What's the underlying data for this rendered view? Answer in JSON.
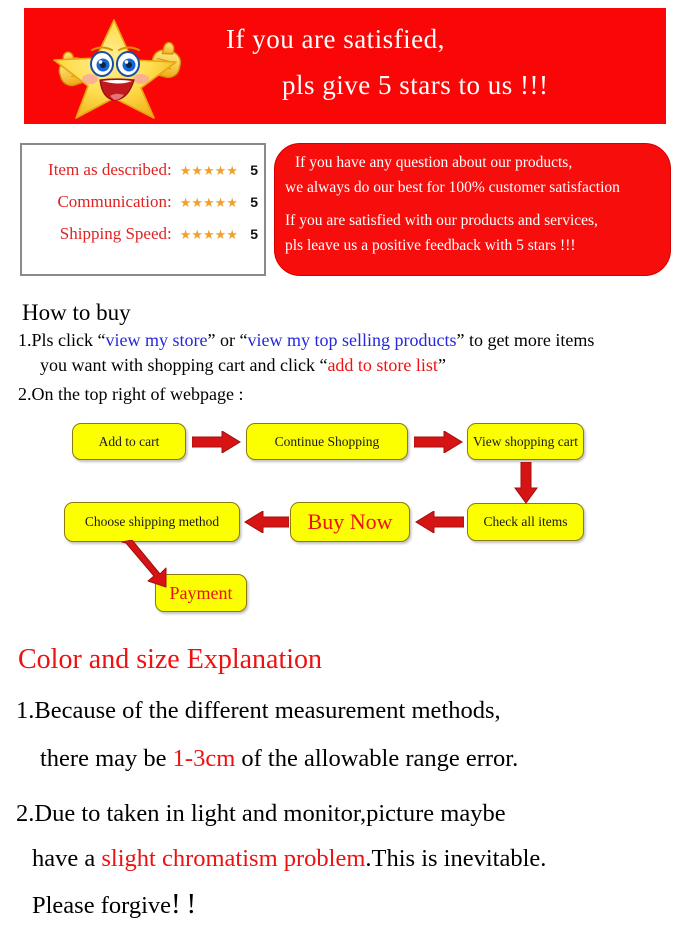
{
  "banner": {
    "bg_color": "#fb0606",
    "text_color": "#ffffff",
    "line1": "If you are satisfied,",
    "line2": "pls give 5 stars to us !!!",
    "mascot": "smiling-star-thumbs-up"
  },
  "ratings": {
    "border_color": "#8a8a8a",
    "label_color": "#e12222",
    "star_color": "#f0a030",
    "rows": [
      {
        "label": "Item as described:",
        "stars": "★★★★★",
        "score": "5"
      },
      {
        "label": "Communication:",
        "stars": "★★★★★",
        "score": "5"
      },
      {
        "label": "Shipping Speed:",
        "stars": "★★★★★",
        "score": "5"
      }
    ]
  },
  "message_box": {
    "bg_color": "#f80d0d",
    "text_color": "#ffffff",
    "line1": "If you have any question about our products,",
    "line2": "we always do our best for 100% customer satisfaction",
    "line3": "If you are satisfied with our products and services,",
    "line4": "pls leave us a positive feedback with 5 stars !!!"
  },
  "how_to_buy": {
    "title": "How to buy",
    "step1_prefix": "1.Pls click “",
    "step1_link1": "view my store",
    "step1_mid": "” or “",
    "step1_link2": "view my top selling products",
    "step1_suffix": "” to get more items",
    "step1b_prefix": "you want with shopping cart and click “",
    "step1b_red": "add to store list",
    "step1b_suffix": "”",
    "step2": "2.On the top right of webpage :",
    "link_color": "#2626dd",
    "highlight_color": "#ee1111"
  },
  "flowchart": {
    "box_fill": "#fcff00",
    "box_border": "#8a7a10",
    "arrow_color": "#d61414",
    "accent_text_color": "#ee1111",
    "boxes": {
      "add_to_cart": "Add to cart",
      "continue_shopping": "Continue Shopping",
      "view_shopping_cart": "View shopping cart",
      "check_all_items": "Check all items",
      "buy_now": "Buy Now",
      "choose_shipping_method": "Choose shipping method",
      "payment": "Payment"
    }
  },
  "color_size": {
    "title": "Color and size Explanation",
    "title_color": "#ee1111",
    "item1_line1": "1.Because of the different measurement methods,",
    "item1_line2_pre": "there may be ",
    "item1_line2_red": "1-3cm",
    "item1_line2_post": " of the allowable range error.",
    "item2_line1": "2.Due to taken in light and monitor,picture maybe",
    "item2_line2_pre": "have a ",
    "item2_line2_red": "slight chromatism problem",
    "item2_line2_post": ".This is inevitable.",
    "item2_line3": "Please forgive",
    "item2_line3_excl": "! !"
  }
}
